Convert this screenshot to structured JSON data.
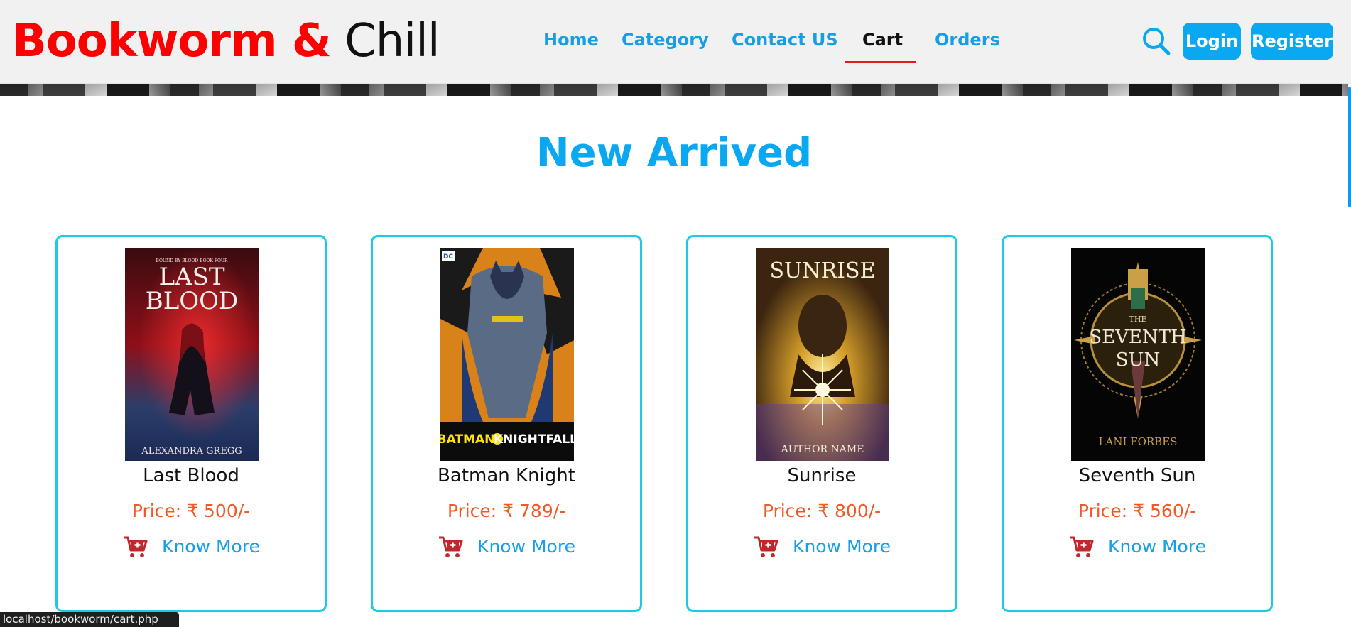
{
  "header": {
    "logo_brand": "Bookworm",
    "logo_sep": "&",
    "logo_chill": "Chill",
    "nav": [
      {
        "label": "Home"
      },
      {
        "label": "Category"
      },
      {
        "label": "Contact US"
      },
      {
        "label": "Cart"
      },
      {
        "label": "Orders"
      }
    ],
    "active_nav": "Cart",
    "login_label": "Login",
    "register_label": "Register"
  },
  "section": {
    "title": "New Arrived"
  },
  "books": [
    {
      "title": "Last Blood",
      "price": "Price: ₹ 500/-",
      "action": "Know More",
      "cover": {
        "top_text": "BOUND BY BLOOD BOOK FOUR",
        "title_line1": "LAST",
        "title_line2": "BLOOD",
        "author": "ALEXANDRA GREGG"
      }
    },
    {
      "title": "Batman Knight",
      "price": "Price: ₹ 789/-",
      "action": "Know More",
      "cover": {
        "publisher": "DC",
        "title_left": "BATMAN",
        "title_right": "KNIGHTFALL"
      }
    },
    {
      "title": "Sunrise",
      "price": "Price: ₹ 800/-",
      "action": "Know More",
      "cover": {
        "title": "SUNRISE",
        "author": "AUTHOR NAME"
      }
    },
    {
      "title": "Seventh Sun",
      "price": "Price: ₹ 560/-",
      "action": "Know More",
      "cover": {
        "top": "THE",
        "title_line1": "SEVENTH",
        "title_line2": "SUN",
        "author": "LANI FORBES"
      }
    }
  ],
  "status_bar": {
    "url": "localhost/bookworm/cart.php"
  },
  "colors": {
    "brand_red": "#ff0000",
    "accent_blue": "#0aa8f0",
    "card_border": "#1ccbe3",
    "price_orange": "#f05a26",
    "cart_red": "#c0282d"
  }
}
